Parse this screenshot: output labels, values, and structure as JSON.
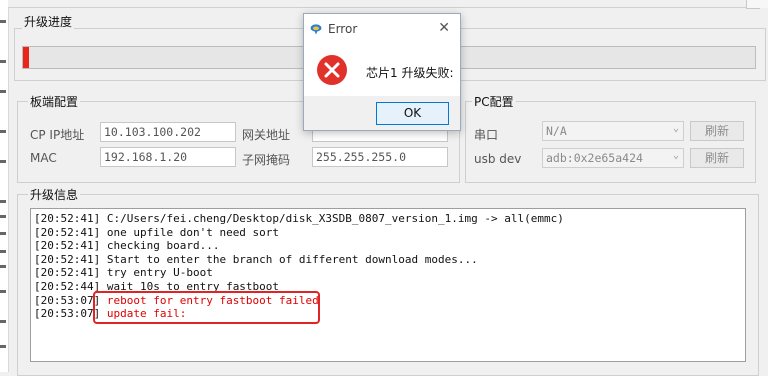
{
  "upgrade_progress": {
    "title": "升级进度",
    "value_fraction": 0.008,
    "fill_color": "#e8261c"
  },
  "board_config": {
    "title": "板端配置",
    "cp_ip_label": "CP IP地址",
    "cp_ip_value": "10.103.100.202",
    "gateway_label": "网关地址",
    "mac_label": "MAC",
    "mac_value": "192.168.1.20",
    "subnet_label": "子网掩码",
    "subnet_value": "255.255.255.0"
  },
  "pc_config": {
    "title": "PC配置",
    "serial_label": "串口",
    "serial_value": "N/A",
    "usb_label": "usb dev",
    "usb_value": "adb:0x2e65a424",
    "refresh_label": "刷新"
  },
  "upgrade_info": {
    "title": "升级信息",
    "log": [
      {
        "time": "[20:52:41]",
        "msg": "C:/Users/fei.cheng/Desktop/disk_X3SDB_0807_version_1.img -> all(emmc)"
      },
      {
        "time": "[20:52:41]",
        "msg": "one upfile don't need sort"
      },
      {
        "time": "[20:52:41]",
        "msg": "checking board..."
      },
      {
        "time": "[20:52:41]",
        "msg": "Start to enter the branch of different download modes..."
      },
      {
        "time": "[20:52:41]",
        "msg": "try entry U-boot"
      },
      {
        "time": "[20:52:44]",
        "msg": "wait 10s to entry fastboot"
      },
      {
        "time": "[20:53:07]",
        "msg": "reboot for entry fastboot failed"
      },
      {
        "time": "[20:53:07]",
        "msg": "update fail:"
      }
    ]
  },
  "dialog": {
    "title": "Error",
    "message": "芯片1 升级失败:",
    "ok_label": "OK",
    "error_color": "#e0312a"
  }
}
